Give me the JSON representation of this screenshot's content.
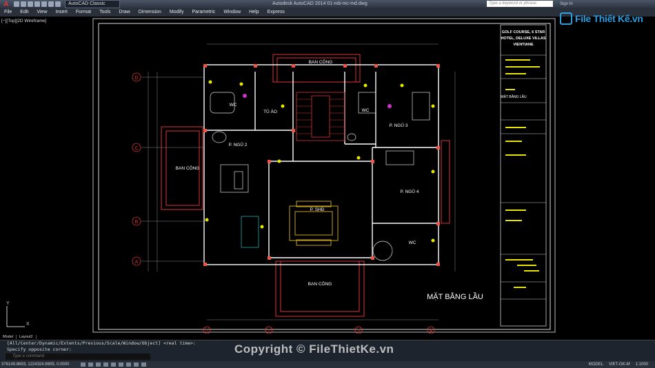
{
  "titlebar": {
    "app_glyph": "A",
    "workspace": "AutoCAD Classic",
    "title": "Autodesk AutoCAD 2014    01-mb-mc-md.dwg",
    "search_placeholder": "Type a keyword or phrase",
    "signin": "Sign In"
  },
  "menu": [
    "File",
    "Edit",
    "View",
    "Insert",
    "Format",
    "Tools",
    "Draw",
    "Dimension",
    "Modify",
    "Parametric",
    "Window",
    "Help",
    "Express"
  ],
  "logo": "File Thiết Kế.vn",
  "viewport_label": "[−][Top][2D Wireframe]",
  "plan": {
    "rooms": {
      "ban_cong_top": "BAN CÔNG",
      "wc_left": "WC",
      "to_ao": "TỦ ÁO",
      "wc_right": "WC",
      "p_ngu_3": "P. NGỦ 3",
      "p_ngu_2": "P. NGỦ 2",
      "ban_cong_left": "BAN CÔNG",
      "p_ngu_4": "P. NGỦ 4",
      "p_shd": "P. SHĐ",
      "wc_bottom": "WC",
      "ban_cong_bottom": "BAN CÔNG"
    },
    "grid_rows": [
      "D",
      "C",
      "B",
      "A"
    ],
    "grid_cols": [
      "1",
      "2",
      "3",
      "4"
    ],
    "sheet_title": "MẶT BẰNG LẦU"
  },
  "titleblock": {
    "project": [
      "GOLF COURSE, 6 STAR",
      "HOTEL, DELUXE VILLAS",
      "VIENTIANE"
    ],
    "sheet": "MẶT BẰNG LẦU"
  },
  "ucs": {
    "x": "X",
    "y": "Y"
  },
  "tabs": [
    "Model",
    "Layout2"
  ],
  "command": {
    "line1": "[All/Center/Dynamic/Extents/Previous/Scale/Window/Object] <real time>:",
    "line2": "Specify opposite corner:",
    "placeholder": "Type a command"
  },
  "status": {
    "coords": "378149.8693, 1224324.8905, 0.0000",
    "model": "MODEL",
    "scale": "VIET-GK-M",
    "zoom": "1:1000"
  },
  "watermark": "Copyright © FileThietKe.vn"
}
